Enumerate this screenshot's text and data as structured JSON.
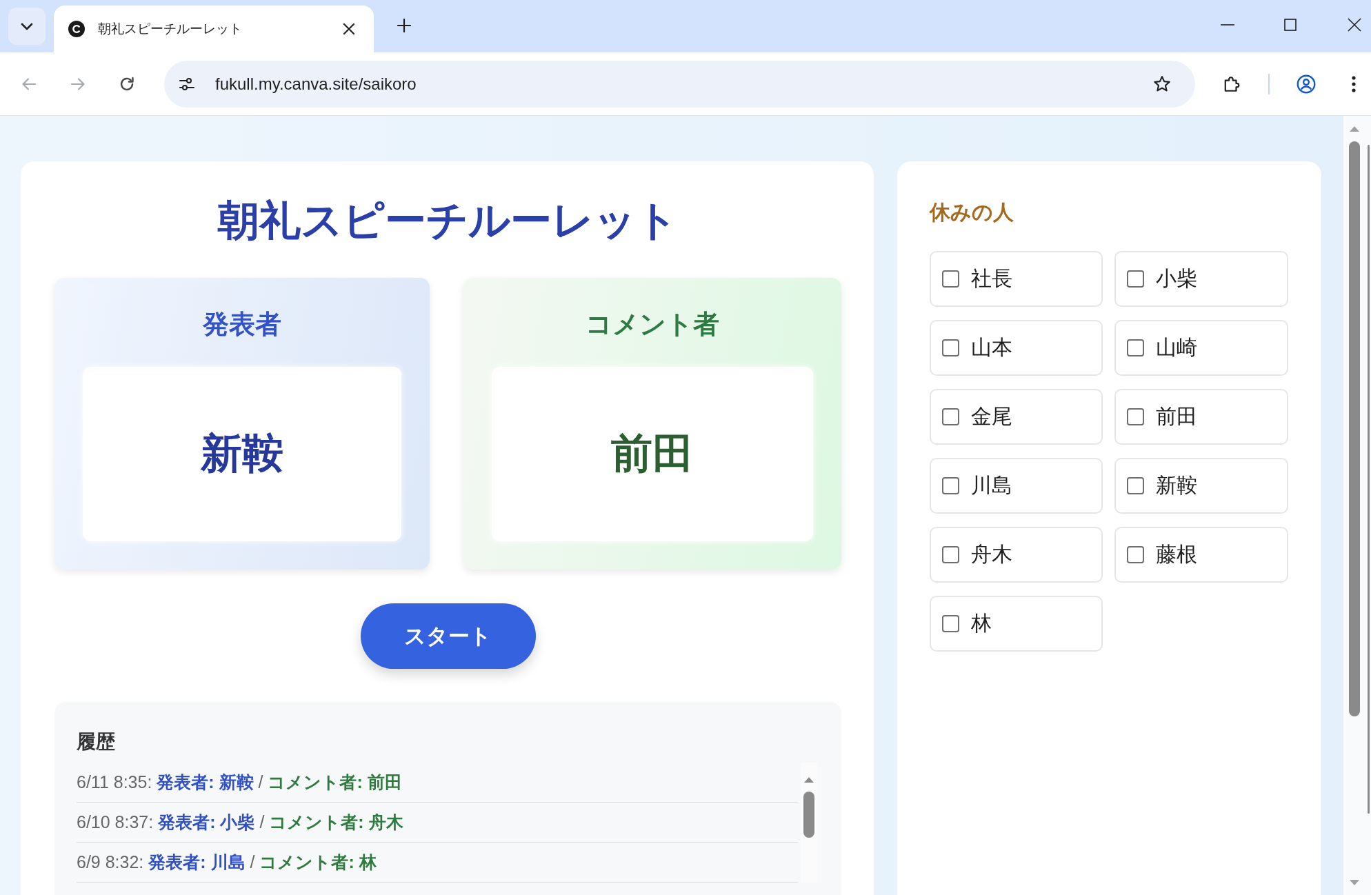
{
  "browser": {
    "tab": {
      "title": "朝礼スピーチルーレット",
      "selected": true
    },
    "nav_buttons": [
      {
        "kind": "back",
        "disabled": true
      },
      {
        "kind": "forward",
        "disabled": true
      },
      {
        "kind": "reload",
        "disabled": false
      }
    ],
    "address_bar": {
      "url": "fukull.my.canva.site/saikoro"
    }
  },
  "roulette": {
    "title": "朝礼スピーチルーレット",
    "roles": [
      {
        "kind": "presenter",
        "label": "発表者",
        "name": "新鞍"
      },
      {
        "kind": "commenter",
        "label": "コメント者",
        "name": "前田"
      }
    ],
    "start_button": "スタート",
    "history": {
      "title": "履歴",
      "entries": [
        {
          "time": "6/11 8:35:",
          "presenter": "発表者: 新鞍",
          "separator": "/",
          "commenter": "コメント者: 前田"
        },
        {
          "time": "6/10 8:37:",
          "presenter": "発表者: 小柴",
          "separator": "/",
          "commenter": "コメント者: 舟木"
        },
        {
          "time": "6/9 8:32:",
          "presenter": "発表者: 川島",
          "separator": "/",
          "commenter": "コメント者: 林"
        }
      ]
    }
  },
  "absent_panel": {
    "title": "休みの人",
    "people": [
      {
        "name": "社長",
        "checked": false
      },
      {
        "name": "小柴",
        "checked": false
      },
      {
        "name": "山本",
        "checked": false
      },
      {
        "name": "山崎",
        "checked": false
      },
      {
        "name": "金尾",
        "checked": false
      },
      {
        "name": "前田",
        "checked": false
      },
      {
        "name": "川島",
        "checked": false
      },
      {
        "name": "新鞍",
        "checked": false
      },
      {
        "name": "舟木",
        "checked": false
      },
      {
        "name": "藤根",
        "checked": false
      },
      {
        "name": "林",
        "checked": false
      }
    ]
  }
}
